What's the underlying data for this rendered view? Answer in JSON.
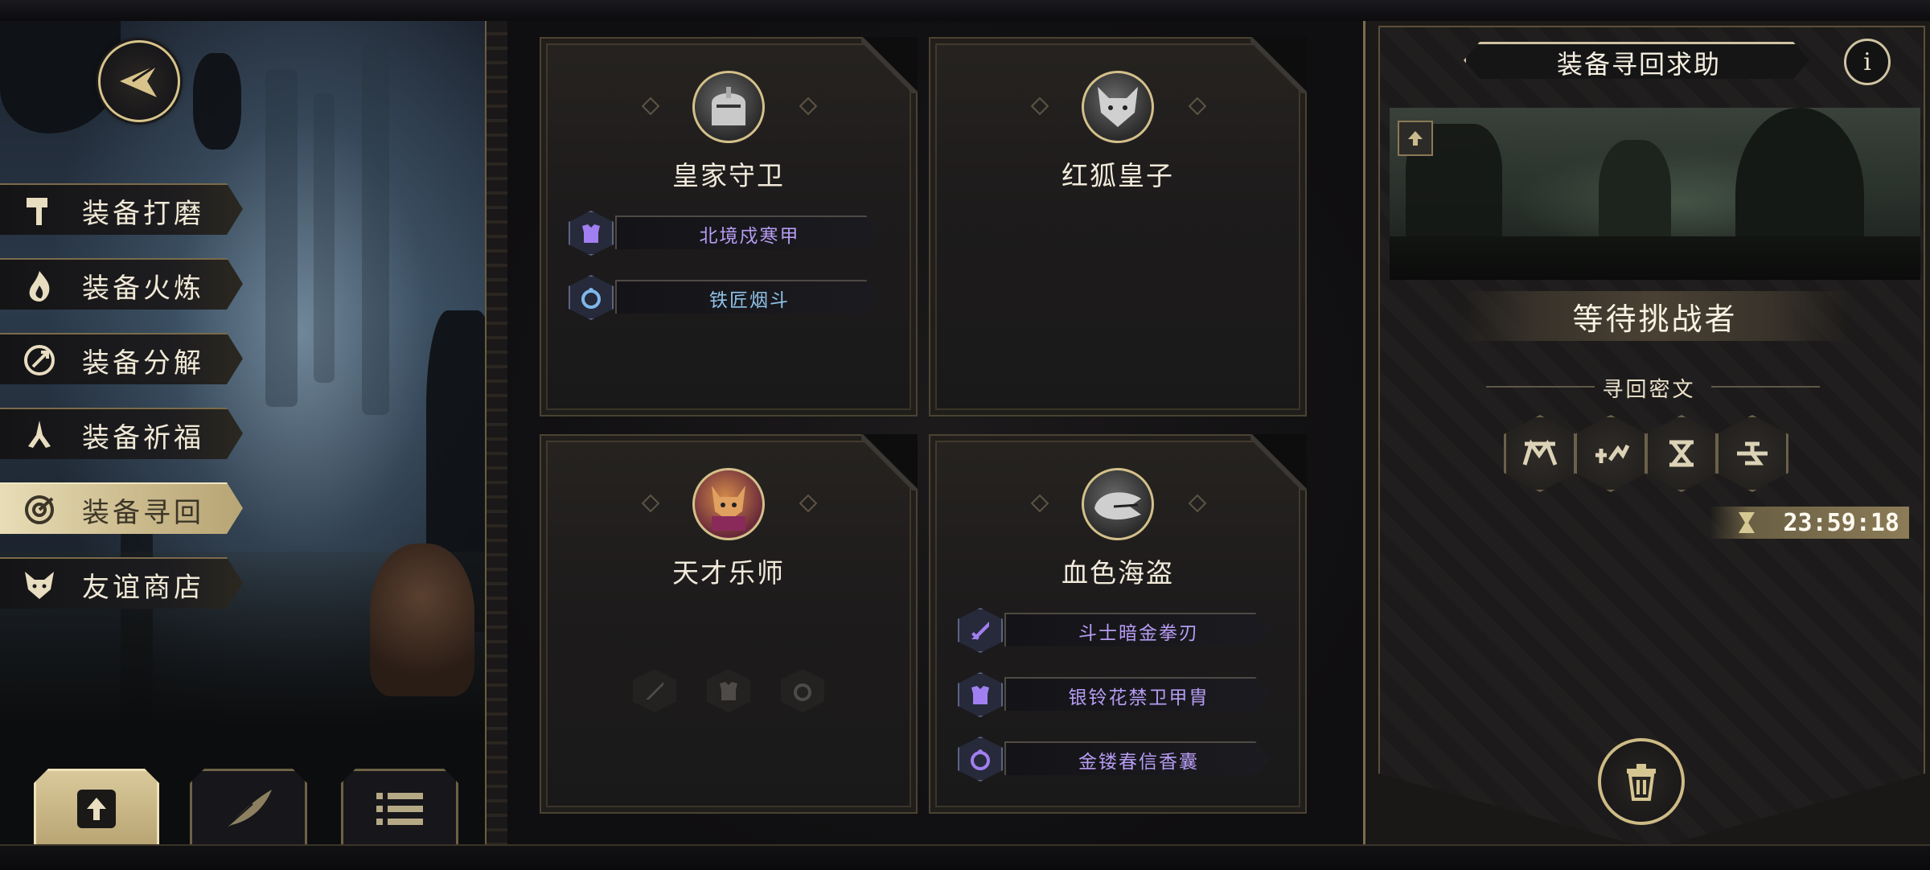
{
  "colors": {
    "gold": "#d8c48b",
    "purple_item": "#b69cf2",
    "blue_item": "#8fc2e8"
  },
  "nav": {
    "back_icon": "back-arrow-icon",
    "menu": [
      {
        "label": "装备打磨",
        "icon": "hammer-icon",
        "active": false
      },
      {
        "label": "装备火炼",
        "icon": "flame-icon",
        "active": false
      },
      {
        "label": "装备分解",
        "icon": "dismantle-icon",
        "active": false
      },
      {
        "label": "装备祈福",
        "icon": "pray-hands-icon",
        "active": false
      },
      {
        "label": "装备寻回",
        "icon": "retrieve-icon",
        "active": true
      },
      {
        "label": "友谊商店",
        "icon": "fox-icon",
        "active": false
      }
    ],
    "bottom_tabs": [
      {
        "icon": "upload-icon",
        "active": true
      },
      {
        "icon": "feather-icon",
        "active": false
      },
      {
        "icon": "list-icon",
        "active": false
      }
    ]
  },
  "cards": [
    {
      "name": "皇家守卫",
      "portrait": "royal-guard-portrait",
      "items": [
        {
          "label": "北境戍寒甲",
          "icon": "armor-icon",
          "color": "purple"
        },
        {
          "label": "铁匠烟斗",
          "icon": "ring-icon",
          "color": "blue"
        }
      ]
    },
    {
      "name": "红狐皇子",
      "portrait": "red-fox-prince-portrait",
      "items": []
    },
    {
      "name": "天才乐师",
      "portrait": "genius-musician-portrait",
      "items": [],
      "empty_slots": [
        "sword-slot-icon",
        "armor-slot-icon",
        "ring-slot-icon"
      ]
    },
    {
      "name": "血色海盗",
      "portrait": "crimson-pirate-portrait",
      "items": [
        {
          "label": "斗士暗金拳刃",
          "icon": "sword-icon",
          "color": "purple"
        },
        {
          "label": "银铃花禁卫甲胄",
          "icon": "armor-icon",
          "color": "purple"
        },
        {
          "label": "金镂春信香囊",
          "icon": "ring-icon",
          "color": "purple"
        }
      ]
    }
  ],
  "panel": {
    "title": "装备寻回求助",
    "info": "i",
    "status": "等待挑战者",
    "cipher_title": "寻回密文",
    "runes": [
      "rune-1-icon",
      "rune-2-icon",
      "rune-3-icon",
      "rune-4-icon"
    ],
    "timer": "23:59:18",
    "trash_icon": "trash-icon"
  }
}
